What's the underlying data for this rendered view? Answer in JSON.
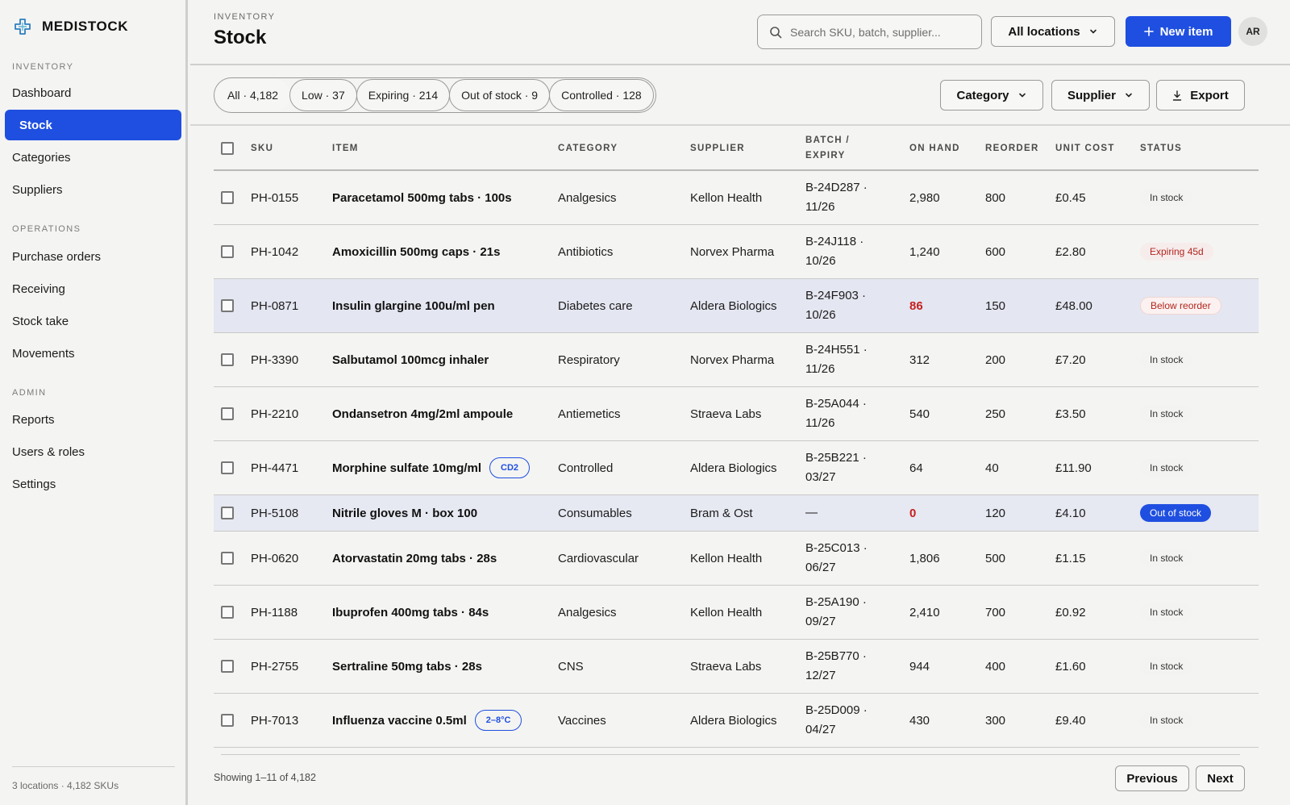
{
  "brand": {
    "name": "MEDISTOCK",
    "logo_icon": "medical-cross-icon"
  },
  "sidebar": {
    "sections": [
      {
        "label": "INVENTORY"
      },
      {
        "label": "OPERATIONS"
      },
      {
        "label": "ADMIN"
      }
    ],
    "items": [
      {
        "label": "Dashboard"
      },
      {
        "label": "Stock",
        "active": true
      },
      {
        "label": "Categories"
      },
      {
        "label": "Suppliers"
      },
      {
        "label": "Purchase orders"
      },
      {
        "label": "Receiving"
      },
      {
        "label": "Stock take"
      },
      {
        "label": "Movements"
      },
      {
        "label": "Reports"
      },
      {
        "label": "Users & roles"
      },
      {
        "label": "Settings"
      }
    ],
    "footer": "3 locations · 4,182 SKUs"
  },
  "header": {
    "eyebrow": "INVENTORY",
    "title": "Stock",
    "search_placeholder": "Search SKU, batch, supplier...",
    "location_label": "All locations",
    "new_item_label": "New item",
    "avatar_initials": "AR"
  },
  "filters": {
    "pills": [
      "All · 4,182",
      "Low · 37",
      "Expiring · 214",
      "Out of stock · 9",
      "Controlled · 128"
    ],
    "category_label": "Category",
    "supplier_label": "Supplier",
    "export_label": "Export"
  },
  "table": {
    "columns": {
      "sku": "SKU",
      "item": "ITEM",
      "category": "CATEGORY",
      "supplier": "SUPPLIER",
      "batch_line1": "BATCH /",
      "batch_line2": "EXPIRY",
      "on_hand": "ON HAND",
      "reorder": "REORDER",
      "unit_cost": "UNIT COST",
      "status": "STATUS"
    },
    "rows": [
      {
        "sku": "PH-0155",
        "item": "Paracetamol 500mg tabs · 100s",
        "tag": "",
        "category": "Analgesics",
        "supplier": "Kellon Health",
        "batch": "B-24D287 ·",
        "expiry": "11/26",
        "on_hand": "2,980",
        "reorder": "800",
        "unit_cost": "£0.45",
        "status": "In stock",
        "status_kind": "normal",
        "on_hand_kind": "normal",
        "row_kind": "normal"
      },
      {
        "sku": "PH-1042",
        "item": "Amoxicillin 500mg caps · 21s",
        "tag": "",
        "category": "Antibiotics",
        "supplier": "Norvex Pharma",
        "batch": "B-24J118 ·",
        "expiry": "10/26",
        "on_hand": "1,240",
        "reorder": "600",
        "unit_cost": "£2.80",
        "status": "Expiring 45d",
        "status_kind": "expiring",
        "on_hand_kind": "normal",
        "row_kind": "normal"
      },
      {
        "sku": "PH-0871",
        "item": "Insulin glargine 100u/ml pen",
        "tag": "",
        "category": "Diabetes care",
        "supplier": "Aldera Biologics",
        "batch": "B-24F903 ·",
        "expiry": "10/26",
        "on_hand": "86",
        "reorder": "150",
        "unit_cost": "£48.00",
        "status": "Below reorder",
        "status_kind": "below",
        "on_hand_kind": "low",
        "row_kind": "highlight"
      },
      {
        "sku": "PH-3390",
        "item": "Salbutamol 100mcg inhaler",
        "tag": "",
        "category": "Respiratory",
        "supplier": "Norvex Pharma",
        "batch": "B-24H551 ·",
        "expiry": "11/26",
        "on_hand": "312",
        "reorder": "200",
        "unit_cost": "£7.20",
        "status": "In stock",
        "status_kind": "normal",
        "on_hand_kind": "normal",
        "row_kind": "normal"
      },
      {
        "sku": "PH-2210",
        "item": "Ondansetron 4mg/2ml ampoule",
        "tag": "",
        "category": "Antiemetics",
        "supplier": "Straeva Labs",
        "batch": "B-25A044 ·",
        "expiry": "11/26",
        "on_hand": "540",
        "reorder": "250",
        "unit_cost": "£3.50",
        "status": "In stock",
        "status_kind": "normal",
        "on_hand_kind": "normal",
        "row_kind": "normal"
      },
      {
        "sku": "PH-4471",
        "item": "Morphine sulfate 10mg/ml",
        "tag": "CD2",
        "category": "Controlled",
        "supplier": "Aldera Biologics",
        "batch": "B-25B221 ·",
        "expiry": "03/27",
        "on_hand": "64",
        "reorder": "40",
        "unit_cost": "£11.90",
        "status": "In stock",
        "status_kind": "normal",
        "on_hand_kind": "normal",
        "row_kind": "normal"
      },
      {
        "sku": "PH-5108",
        "item": "Nitrile gloves M · box 100",
        "tag": "",
        "category": "Consumables",
        "supplier": "Bram & Ost",
        "batch": "—",
        "expiry": "",
        "on_hand": "0",
        "reorder": "120",
        "unit_cost": "£4.10",
        "status": "Out of stock",
        "status_kind": "out",
        "on_hand_kind": "low",
        "row_kind": "highlight-short"
      },
      {
        "sku": "PH-0620",
        "item": "Atorvastatin 20mg tabs · 28s",
        "tag": "",
        "category": "Cardiovascular",
        "supplier": "Kellon Health",
        "batch": "B-25C013 ·",
        "expiry": "06/27",
        "on_hand": "1,806",
        "reorder": "500",
        "unit_cost": "£1.15",
        "status": "In stock",
        "status_kind": "normal",
        "on_hand_kind": "normal",
        "row_kind": "normal"
      },
      {
        "sku": "PH-1188",
        "item": "Ibuprofen 400mg tabs · 84s",
        "tag": "",
        "category": "Analgesics",
        "supplier": "Kellon Health",
        "batch": "B-25A190 ·",
        "expiry": "09/27",
        "on_hand": "2,410",
        "reorder": "700",
        "unit_cost": "£0.92",
        "status": "In stock",
        "status_kind": "normal",
        "on_hand_kind": "normal",
        "row_kind": "normal"
      },
      {
        "sku": "PH-2755",
        "item": "Sertraline 50mg tabs · 28s",
        "tag": "",
        "category": "CNS",
        "supplier": "Straeva Labs",
        "batch": "B-25B770 ·",
        "expiry": "12/27",
        "on_hand": "944",
        "reorder": "400",
        "unit_cost": "£1.60",
        "status": "In stock",
        "status_kind": "normal",
        "on_hand_kind": "normal",
        "row_kind": "normal"
      },
      {
        "sku": "PH-7013",
        "item": "Influenza vaccine 0.5ml",
        "tag": "2–8°C",
        "category": "Vaccines",
        "supplier": "Aldera Biologics",
        "batch": "B-25D009 ·",
        "expiry": "04/27",
        "on_hand": "430",
        "reorder": "300",
        "unit_cost": "£9.40",
        "status": "In stock",
        "status_kind": "normal",
        "on_hand_kind": "normal",
        "row_kind": "normal"
      }
    ]
  },
  "pagination": {
    "showing": "Showing 1–11 of 4,182",
    "previous_label": "Previous",
    "next_label": "Next"
  },
  "colors": {
    "accent": "#1f4fe0",
    "danger": "#c62020",
    "highlight_row": "#e4e6f1"
  }
}
